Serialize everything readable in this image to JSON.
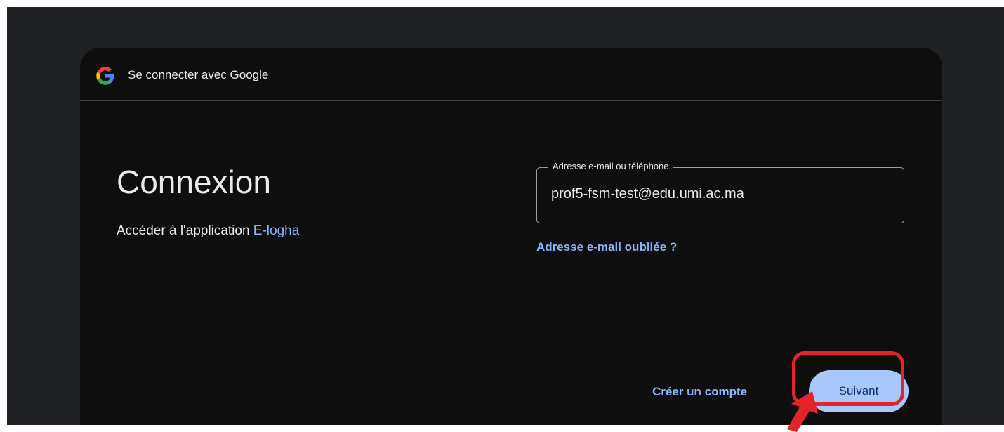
{
  "header": {
    "title": "Se connecter avec Google",
    "logo_icon": "google-g-icon"
  },
  "main": {
    "title": "Connexion",
    "subtitle_prefix": "Accéder à l'application ",
    "app_name": "E-logha"
  },
  "email_field": {
    "label": "Adresse e-mail ou téléphone",
    "value": "prof5-fsm-test@edu.umi.ac.ma"
  },
  "links": {
    "forgot_email": "Adresse e-mail oubliée ?",
    "create_account": "Créer un compte"
  },
  "buttons": {
    "next": "Suivant"
  },
  "annotation": {
    "highlight_color": "#e3252b",
    "arrow_icon": "red-pointer-arrow-icon"
  },
  "colors": {
    "accent": "#8ab4f8",
    "button_bg": "#a8c7fa",
    "card_bg": "#0e0e0f",
    "page_bg": "#202124"
  }
}
